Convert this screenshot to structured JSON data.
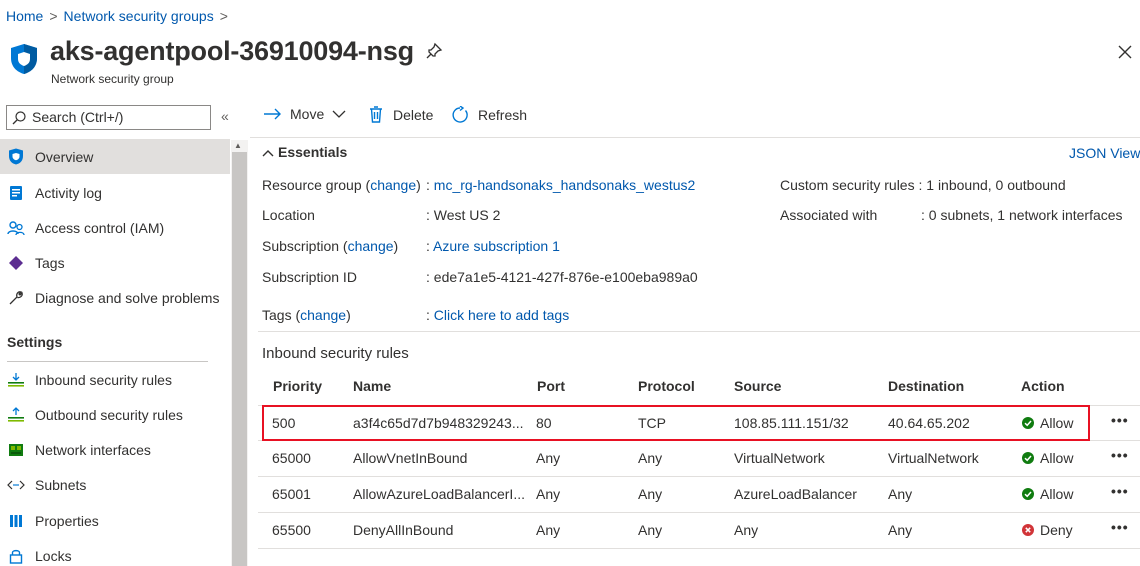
{
  "breadcrumb": {
    "home": "Home",
    "sep": ">",
    "nsg": "Network security groups",
    "trail": ">"
  },
  "page": {
    "title": "aks-agentpool-36910094-nsg",
    "subtitle": "Network security group"
  },
  "sidebar": {
    "search_placeholder": "Search (Ctrl+/)",
    "collapse": "«",
    "items": [
      {
        "label": "Overview",
        "icon": "shield-icon"
      },
      {
        "label": "Activity log",
        "icon": "activity-log-icon"
      },
      {
        "label": "Access control (IAM)",
        "icon": "people-icon"
      },
      {
        "label": "Tags",
        "icon": "tag-icon"
      },
      {
        "label": "Diagnose and solve problems",
        "icon": "wrench-icon"
      }
    ],
    "settings_header": "Settings",
    "settings_items": [
      {
        "label": "Inbound security rules",
        "icon": "inbound-rules-icon"
      },
      {
        "label": "Outbound security rules",
        "icon": "outbound-rules-icon"
      },
      {
        "label": "Network interfaces",
        "icon": "network-interface-icon"
      },
      {
        "label": "Subnets",
        "icon": "subnet-icon"
      },
      {
        "label": "Properties",
        "icon": "properties-icon"
      },
      {
        "label": "Locks",
        "icon": "lock-icon"
      }
    ]
  },
  "toolbar": {
    "move": "Move",
    "delete": "Delete",
    "refresh": "Refresh"
  },
  "essentials": {
    "toggle": "Essentials",
    "json_view": "JSON View",
    "resource_group_label": "Resource group",
    "change": "change",
    "resource_group_value": "mc_rg-handsonaks_handsonaks_westus2",
    "location_label": "Location",
    "location_value": "West US 2",
    "subscription_label": "Subscription",
    "subscription_value": "Azure subscription 1",
    "subscription_id_label": "Subscription ID",
    "subscription_id_value": "ede7a1e5-4121-427f-876e-e100eba989a0",
    "tags_label": "Tags",
    "tags_value": "Click here to add tags",
    "custom_rules_label": "Custom security rules",
    "custom_rules_value": "1 inbound, 0 outbound",
    "associated_label": "Associated with",
    "associated_value": "0 subnets, 1 network interfaces",
    "colon": ":"
  },
  "inbound": {
    "title": "Inbound security rules",
    "columns": [
      "Priority",
      "Name",
      "Port",
      "Protocol",
      "Source",
      "Destination",
      "Action"
    ],
    "rows": [
      {
        "priority": "500",
        "name": "a3f4c65d7d7b948329243...",
        "port": "80",
        "protocol": "TCP",
        "source": "108.85.111.151/32",
        "destination": "40.64.65.202",
        "action": "Allow"
      },
      {
        "priority": "65000",
        "name": "AllowVnetInBound",
        "port": "Any",
        "protocol": "Any",
        "source": "VirtualNetwork",
        "destination": "VirtualNetwork",
        "action": "Allow"
      },
      {
        "priority": "65001",
        "name": "AllowAzureLoadBalancerI...",
        "port": "Any",
        "protocol": "Any",
        "source": "AzureLoadBalancer",
        "destination": "Any",
        "action": "Allow"
      },
      {
        "priority": "65500",
        "name": "DenyAllInBound",
        "port": "Any",
        "protocol": "Any",
        "source": "Any",
        "destination": "Any",
        "action": "Deny"
      }
    ],
    "more": "•••"
  },
  "colors": {
    "link": "#0058ad",
    "allow": "#107c10",
    "deny": "#d13438",
    "highlight": "#e81123",
    "shield": "#0078d4"
  }
}
